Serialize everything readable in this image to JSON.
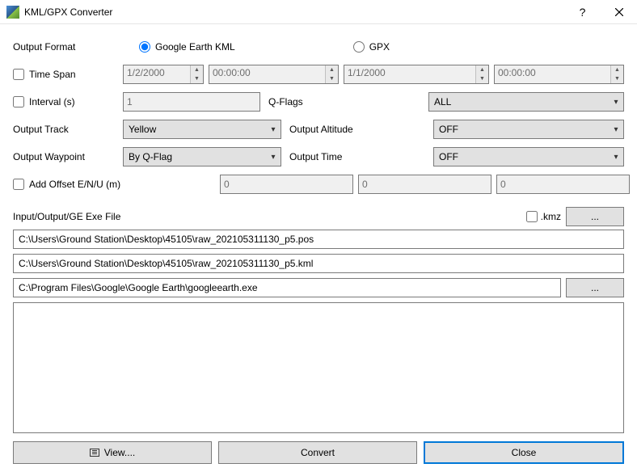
{
  "title": "KML/GPX Converter",
  "labels": {
    "output_format": "Output Format",
    "google_kml": "Google Earth KML",
    "gpx": "GPX",
    "time_span": "Time Span",
    "interval": "Interval (s)",
    "q_flags": "Q-Flags",
    "output_track": "Output Track",
    "output_altitude": "Output Altitude",
    "output_waypoint": "Output Waypoint",
    "output_time": "Output Time",
    "add_offset": "Add Offset E/N/U (m)",
    "io_label": "Input/Output/GE Exe File",
    "kmz": ".kmz",
    "browse": "...",
    "view": "View....",
    "convert": "Convert",
    "close": "Close"
  },
  "values": {
    "time_start_date": "1/2/2000",
    "time_start_time": "00:00:00",
    "time_end_date": "1/1/2000",
    "time_end_time": "00:00:00",
    "interval": "1",
    "q_flags": "ALL",
    "output_track": "Yellow",
    "output_altitude": "OFF",
    "output_waypoint": "By Q-Flag",
    "output_time": "OFF",
    "offset_e": "0",
    "offset_n": "0",
    "offset_u": "0",
    "input_path": "C:\\Users\\Ground Station\\Desktop\\45105\\raw_202105311130_p5.pos",
    "output_path": "C:\\Users\\Ground Station\\Desktop\\45105\\raw_202105311130_p5.kml",
    "ge_path": "C:\\Program Files\\Google\\Google Earth\\googleearth.exe"
  }
}
